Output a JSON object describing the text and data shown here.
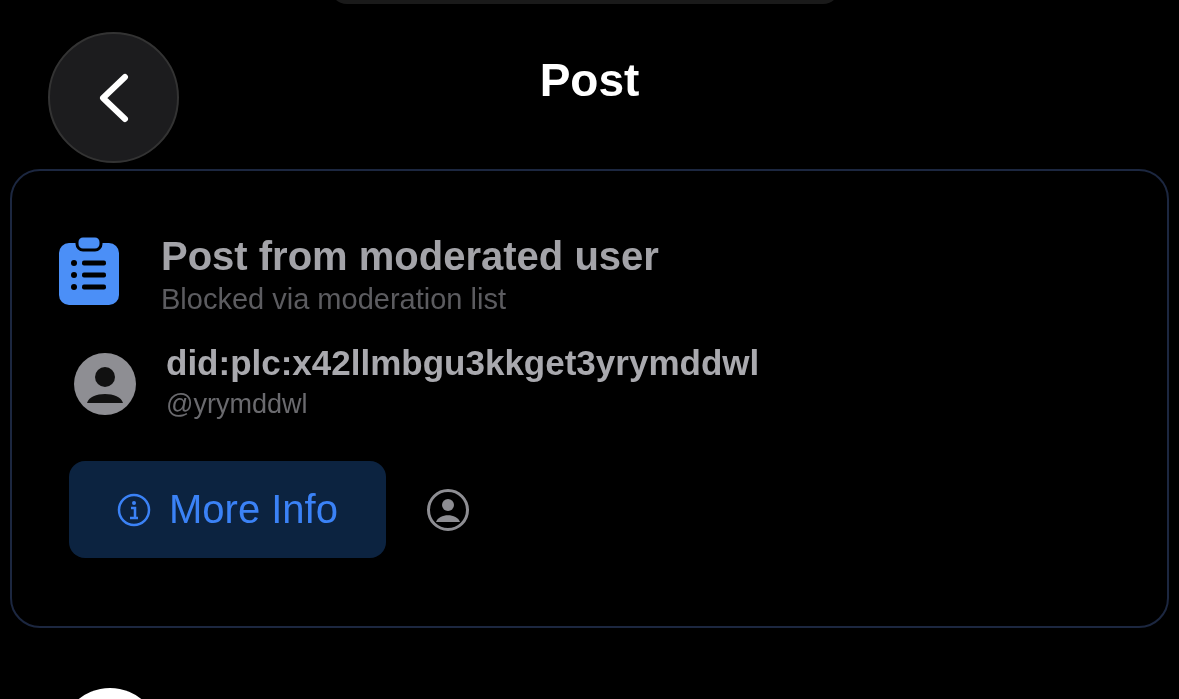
{
  "header": {
    "title": "Post"
  },
  "moderation_card": {
    "title": "Post from moderated user",
    "subtitle": "Blocked via moderation list",
    "author": {
      "did": "did:plc:x42llmbgu3kkget3yrymddwl",
      "handle": "@yrymddwl"
    },
    "button": {
      "label": "More Info"
    }
  }
}
